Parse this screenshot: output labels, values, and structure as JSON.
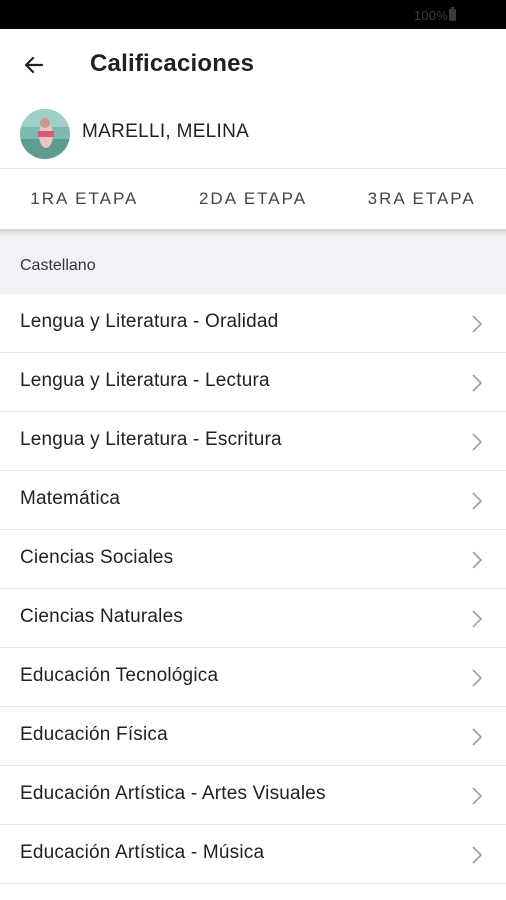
{
  "status_bar": {
    "battery_text": "100%"
  },
  "app_bar": {
    "title": "Calificaciones"
  },
  "student": {
    "name": "MARELLI, MELINA"
  },
  "tabs": [
    {
      "label": "1RA ETAPA"
    },
    {
      "label": "2DA ETAPA"
    },
    {
      "label": "3RA ETAPA"
    }
  ],
  "section": {
    "label": "Castellano"
  },
  "subjects": [
    {
      "label": "Lengua y Literatura - Oralidad"
    },
    {
      "label": "Lengua y Literatura - Lectura"
    },
    {
      "label": "Lengua y Literatura - Escritura"
    },
    {
      "label": "Matemática"
    },
    {
      "label": "Ciencias Sociales"
    },
    {
      "label": "Ciencias Naturales"
    },
    {
      "label": "Educación Tecnológica"
    },
    {
      "label": "Educación Física"
    },
    {
      "label": "Educación Artística - Artes Visuales"
    },
    {
      "label": "Educación Artística - Música"
    }
  ],
  "icons": {
    "back": "arrow-left-icon",
    "chevron": "chevron-right-icon",
    "battery": "battery-icon"
  }
}
